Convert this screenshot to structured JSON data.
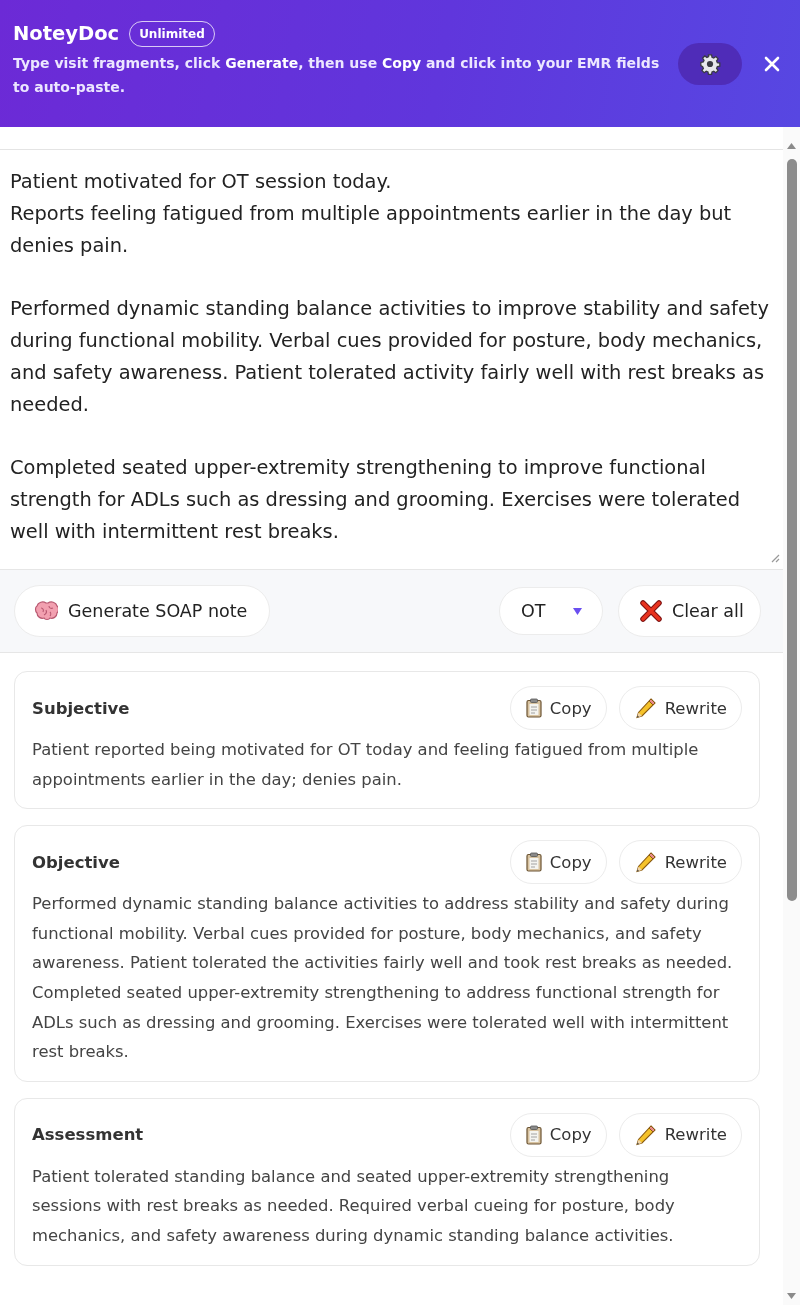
{
  "header": {
    "title": "NoteyDoc",
    "badge": "Unlimited",
    "subtitle": "Type visit fragments, click **Generate**, then use **Copy** and click into your EMR fields to auto-paste."
  },
  "notes": {
    "value": "Patient motivated for OT session today.\nReports feeling fatigued from multiple appointments earlier in the day but denies pain.\n\nPerformed dynamic standing balance activities to improve stability and safety during functional mobility. Verbal cues provided for posture, body mechanics, and safety awareness. Patient tolerated activity fairly well with rest breaks as needed.\n\nCompleted seated upper-extremity strengthening to improve functional strength for ADLs such as dressing and grooming. Exercises were tolerated well with intermittent rest breaks."
  },
  "toolbar": {
    "generate_button": "Generate SOAP note",
    "discipline_select": {
      "value": "OT"
    },
    "clear_button": "Clear all"
  },
  "sections": [
    {
      "title": "Subjective",
      "text": "Patient reported being motivated for OT today and feeling fatigued from multiple appointments earlier in the day; denies pain.",
      "buttons": [
        {
          "kind": "copy",
          "label": "Copy"
        },
        {
          "kind": "rewrite",
          "label": "Rewrite"
        }
      ]
    },
    {
      "title": "Objective",
      "text": "Performed dynamic standing balance activities to address stability and safety during functional mobility. Verbal cues provided for posture, body mechanics, and safety awareness. Patient tolerated the activities fairly well and took rest breaks as needed. Completed seated upper-extremity strengthening to address functional strength for ADLs such as dressing and grooming. Exercises were tolerated well with intermittent rest breaks.",
      "buttons": [
        {
          "kind": "copy",
          "label": "Copy"
        },
        {
          "kind": "rewrite",
          "label": "Rewrite"
        }
      ]
    },
    {
      "title": "Assessment",
      "text": "Patient tolerated standing balance and seated upper-extremity strengthening sessions with rest breaks as needed. Required verbal cueing for posture, body mechanics, and safety awareness during dynamic standing balance activities.",
      "buttons": [
        {
          "kind": "copy",
          "label": "Copy"
        },
        {
          "kind": "rewrite",
          "label": "Rewrite"
        }
      ]
    }
  ]
}
